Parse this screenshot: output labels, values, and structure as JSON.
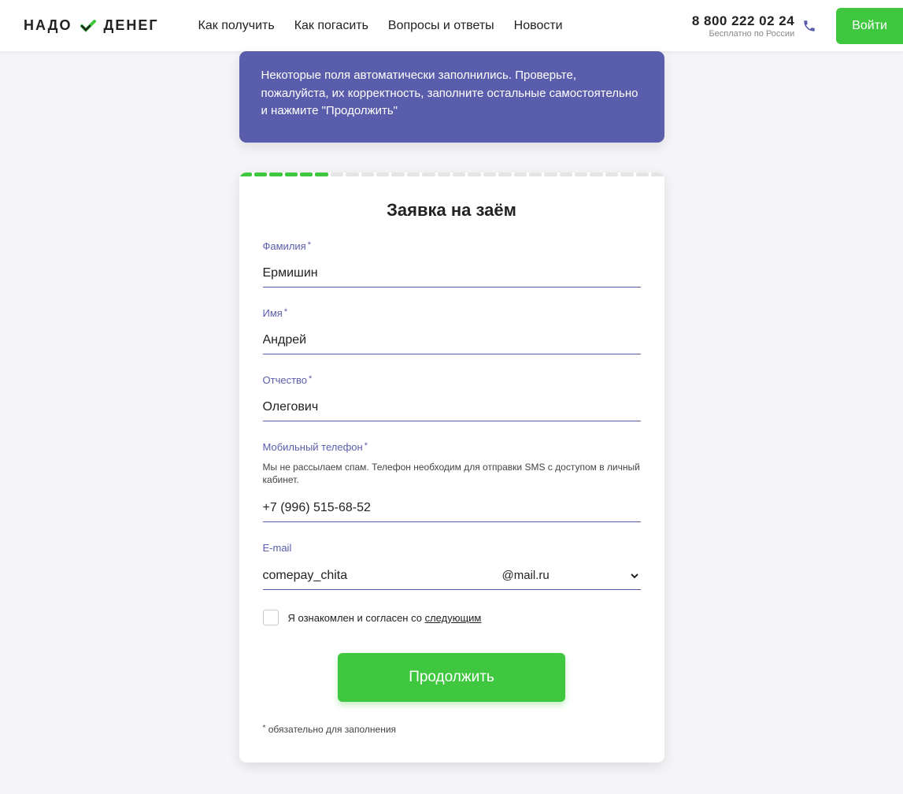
{
  "header": {
    "logo_part1": "НАДО",
    "logo_part2": "ДЕНЕГ",
    "nav": {
      "how_get": "Как получить",
      "how_repay": "Как погасить",
      "qa": "Вопросы и ответы",
      "news": "Новости"
    },
    "phone": "8 800 222 02 24",
    "phone_sub": "Бесплатно по России",
    "login": "Войти"
  },
  "banner": {
    "text": "Некоторые поля автоматически заполнились. Проверьте, пожалуйста, их корректность, заполните остальные самостоятельно и нажмите \"Продолжить\""
  },
  "form": {
    "title": "Заявка на заём",
    "fields": {
      "lastname": {
        "label": "Фамилия",
        "value": "Ермишин"
      },
      "firstname": {
        "label": "Имя",
        "value": "Андрей"
      },
      "patronymic": {
        "label": "Отчество",
        "value": "Олегович"
      },
      "phone": {
        "label": "Мобильный телефон",
        "hint": "Мы не рассылаем спам. Телефон необходим для отправки SMS с доступом в личный кабинет.",
        "value": "+7 (996) 515-68-52"
      },
      "email": {
        "label": "E-mail",
        "value": "comepay_chita",
        "domain": "@mail.ru"
      }
    },
    "consent": {
      "text_prefix": "Я ознакомлен и согласен со ",
      "link": "следующим"
    },
    "submit": "Продолжить",
    "required_note": "обязательно для заполнения"
  }
}
